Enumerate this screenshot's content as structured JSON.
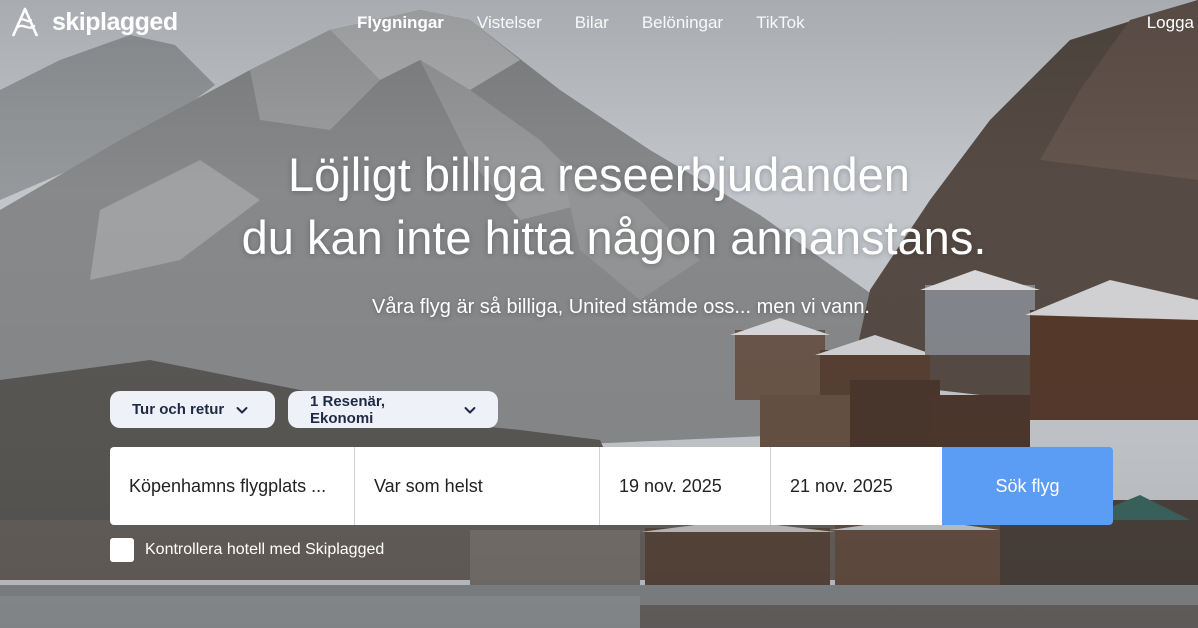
{
  "brand": {
    "name": "skiplagged"
  },
  "nav": {
    "items": [
      {
        "label": "Flygningar"
      },
      {
        "label": "Vistelser"
      },
      {
        "label": "Bilar"
      },
      {
        "label": "Belöningar"
      },
      {
        "label": "TikTok"
      }
    ],
    "login_label": "Logga"
  },
  "hero": {
    "headline_line1": "Löjligt billiga reseerbjudanden",
    "headline_line2": "du kan inte hitta någon annanstans.",
    "subheadline": "Våra flyg är så billiga, United stämde oss... men vi vann."
  },
  "search": {
    "trip_type": "Tur och retur",
    "travelers": "1 Resenär, Ekonomi",
    "origin": "Köpenhamns flygplats ...",
    "destination": "Var som helst",
    "depart_date": "19 nov. 2025",
    "return_date": "21 nov. 2025",
    "submit_label": "Sök flyg",
    "hotel_checkbox_label": "Kontrollera hotell med Skiplagged"
  },
  "colors": {
    "search_button": "#5b9cf5",
    "pill_bg": "#eef1f8",
    "pill_text": "#1f2a44"
  }
}
